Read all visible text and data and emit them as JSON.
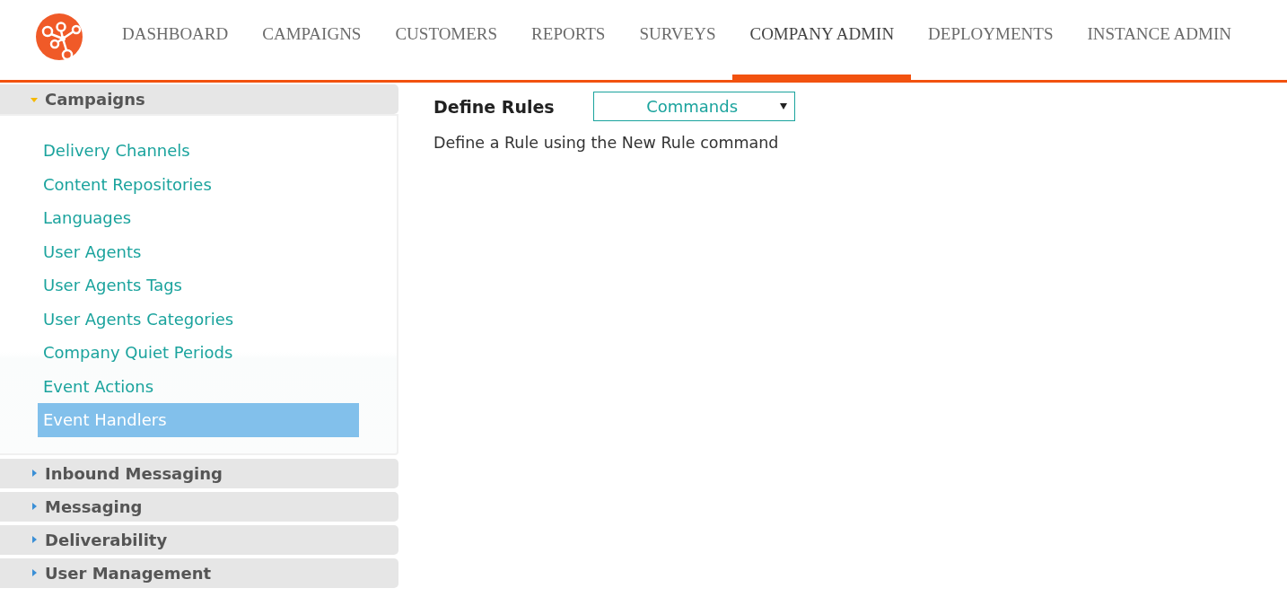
{
  "nav": {
    "tabs": [
      {
        "label": "DASHBOARD",
        "selected": false
      },
      {
        "label": "CAMPAIGNS",
        "selected": false
      },
      {
        "label": "CUSTOMERS",
        "selected": false
      },
      {
        "label": "REPORTS",
        "selected": false
      },
      {
        "label": "SURVEYS",
        "selected": false
      },
      {
        "label": "COMPANY ADMIN",
        "selected": true
      },
      {
        "label": "DEPLOYMENTS",
        "selected": false
      },
      {
        "label": "INSTANCE ADMIN",
        "selected": false
      }
    ]
  },
  "sidebar": {
    "sections": [
      {
        "title": "Campaigns",
        "expanded": true,
        "items": [
          {
            "label": "Delivery Channels",
            "selected": false
          },
          {
            "label": "Content Repositories",
            "selected": false
          },
          {
            "label": "Languages",
            "selected": false
          },
          {
            "label": "User Agents",
            "selected": false
          },
          {
            "label": "User Agents Tags",
            "selected": false
          },
          {
            "label": "User Agents Categories",
            "selected": false
          },
          {
            "label": "Company Quiet Periods",
            "selected": false
          },
          {
            "label": "Event Actions",
            "selected": false
          },
          {
            "label": "Event Handlers",
            "selected": true
          }
        ]
      },
      {
        "title": "Inbound Messaging",
        "expanded": false
      },
      {
        "title": "Messaging",
        "expanded": false
      },
      {
        "title": "Deliverability",
        "expanded": false
      },
      {
        "title": "User Management",
        "expanded": false
      }
    ]
  },
  "main": {
    "title": "Define Rules",
    "dropdown": {
      "value": "Commands"
    },
    "message": "Define a Rule using the New Rule command"
  }
}
